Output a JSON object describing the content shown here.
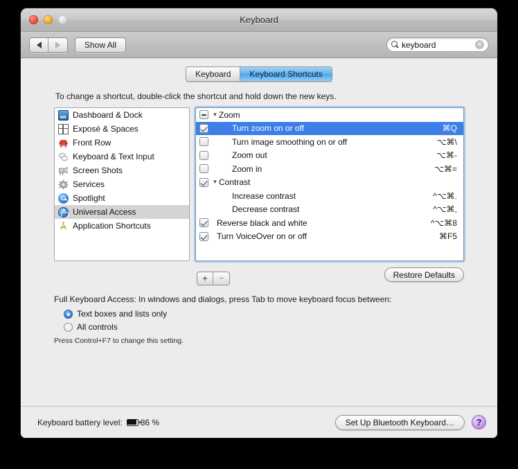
{
  "window": {
    "title": "Keyboard",
    "traffic_lights": [
      "close",
      "minimize",
      "zoom"
    ]
  },
  "toolbar": {
    "back_label": "◀",
    "forward_label": "▶",
    "show_all_label": "Show All",
    "search": {
      "value": "keyboard",
      "placeholder": "Search",
      "icon": "search-icon",
      "clear_icon": "✕"
    }
  },
  "tabs": [
    {
      "label": "Keyboard",
      "active": false
    },
    {
      "label": "Keyboard Shortcuts",
      "active": true
    }
  ],
  "instruction": "To change a shortcut, double-click the shortcut and hold down the new keys.",
  "sidebar": {
    "items": [
      {
        "label": "Dashboard & Dock",
        "icon": "dashboard-icon",
        "selected": false
      },
      {
        "label": "Exposé & Spaces",
        "icon": "grid-spaces-icon",
        "selected": false
      },
      {
        "label": "Front Row",
        "icon": "front-row-chair-icon",
        "selected": false
      },
      {
        "label": "Keyboard & Text Input",
        "icon": "speech-bubbles-icon",
        "selected": false
      },
      {
        "label": "Screen Shots",
        "icon": "screenshot-camera-icon",
        "selected": false
      },
      {
        "label": "Services",
        "icon": "gear-icon",
        "selected": false
      },
      {
        "label": "Spotlight",
        "icon": "spotlight-magnifier-icon",
        "selected": false
      },
      {
        "label": "Universal Access",
        "icon": "universal-access-icon",
        "selected": true
      },
      {
        "label": "Application Shortcuts",
        "icon": "application-a-icon",
        "selected": false
      }
    ]
  },
  "shortcuts": {
    "rows": [
      {
        "label": "Zoom",
        "key": "",
        "checkbox": "mixed",
        "disclosure": "▼",
        "indent": "group",
        "selected": false
      },
      {
        "label": "Turn zoom on or off",
        "key": "⌘Q",
        "checkbox": "on",
        "disclosure": "",
        "indent": "child",
        "selected": true
      },
      {
        "label": "Turn image smoothing on or off",
        "key": "⌥⌘\\",
        "checkbox": "off",
        "disclosure": "",
        "indent": "child",
        "selected": false
      },
      {
        "label": "Zoom out",
        "key": "⌥⌘-",
        "checkbox": "off",
        "disclosure": "",
        "indent": "child",
        "selected": false
      },
      {
        "label": "Zoom in",
        "key": "⌥⌘=",
        "checkbox": "off",
        "disclosure": "",
        "indent": "child",
        "selected": false
      },
      {
        "label": "Contrast",
        "key": "",
        "checkbox": "on",
        "disclosure": "▼",
        "indent": "group",
        "selected": false
      },
      {
        "label": "Increase contrast",
        "key": "^⌥⌘.",
        "checkbox": "none",
        "disclosure": "",
        "indent": "child",
        "selected": false
      },
      {
        "label": "Decrease contrast",
        "key": "^⌥⌘,",
        "checkbox": "none",
        "disclosure": "",
        "indent": "child",
        "selected": false
      },
      {
        "label": "Reverse black and white",
        "key": "^⌥⌘8",
        "checkbox": "on",
        "disclosure": "",
        "indent": "top",
        "selected": false
      },
      {
        "label": "Turn VoiceOver on or off",
        "key": "⌘F5",
        "checkbox": "on",
        "disclosure": "",
        "indent": "top",
        "selected": false
      }
    ]
  },
  "list_controls": {
    "add_label": "+",
    "remove_label": "−",
    "restore_defaults_label": "Restore Defaults"
  },
  "full_keyboard_access": {
    "title": "Full Keyboard Access: In windows and dialogs, press Tab to move keyboard focus between:",
    "options": [
      {
        "label": "Text boxes and lists only",
        "selected": true
      },
      {
        "label": "All controls",
        "selected": false
      }
    ],
    "note": "Press Control+F7 to change this setting."
  },
  "bottom": {
    "battery_label": "Keyboard battery level:",
    "battery_icon": "battery-icon",
    "battery_value": "86 %",
    "bluetooth_button_label": "Set Up Bluetooth Keyboard…",
    "help_button_label": "?"
  },
  "colors": {
    "selection_blue": "#3d7ee8",
    "tab_active_blue": "#4da6ec",
    "sidebar_selection_gray": "#d4d4d4",
    "window_bg": "#ececec",
    "help_purple": "#c9a0ec"
  }
}
